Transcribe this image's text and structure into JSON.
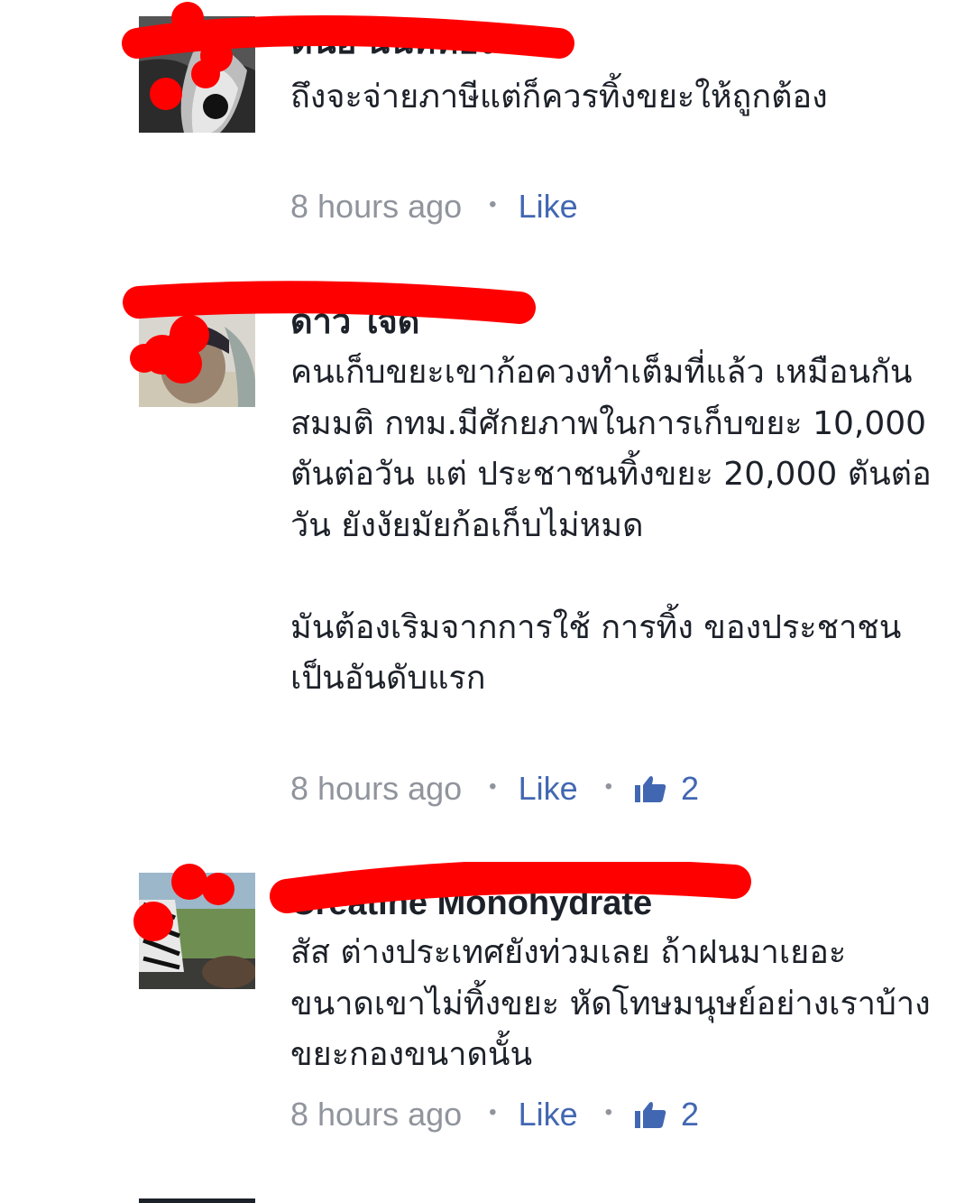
{
  "comments": [
    {
      "author": "ต้นอ้ นนท์ทอง",
      "text": [
        "ถึงจะจ่ายภาษีแต่ก็ควรทิ้งขยะให้ถูกต้อง"
      ],
      "time": "8 hours ago",
      "separator": "•",
      "like_label": "Like",
      "like_count": null
    },
    {
      "author": "ดาว ใจดี",
      "text": [
        "คนเก็บขยะเขาก้อควงทำเต็มที่แล้ว เหมือนกัน สมมติ กทม.มีศักยภาพในการเก็บขยะ 10,000 ตันต่อวัน แต่ ประชาชนทิ้งขยะ 20,000 ตันต่อวัน ยังงัยมัยก้อเก็บไม่หมด",
        "มันต้องเริมจากการใช้ การทิ้ง ของประชาชนเป็นอันดับแรก"
      ],
      "time": "8 hours ago",
      "separator": "•",
      "like_label": "Like",
      "like_separator": "•",
      "like_count": "2"
    },
    {
      "author": "Creatine Monohydrate",
      "text": [
        "สัส ต่างประเทศยังท่วมเลย ถ้าฝนมาเยอะ ขนาดเขาไม่ทิ้งขยะ หัดโทษมนุษย์อย่างเราบ้าง ขยะกองขนาดนั้น"
      ],
      "time": "8 hours ago",
      "separator": "•",
      "like_label": "Like",
      "like_separator": "•",
      "like_count": "2"
    }
  ],
  "colors": {
    "link": "#4267b2",
    "meta": "#90949c",
    "text": "#1d2129",
    "redaction": "#ff0000"
  }
}
